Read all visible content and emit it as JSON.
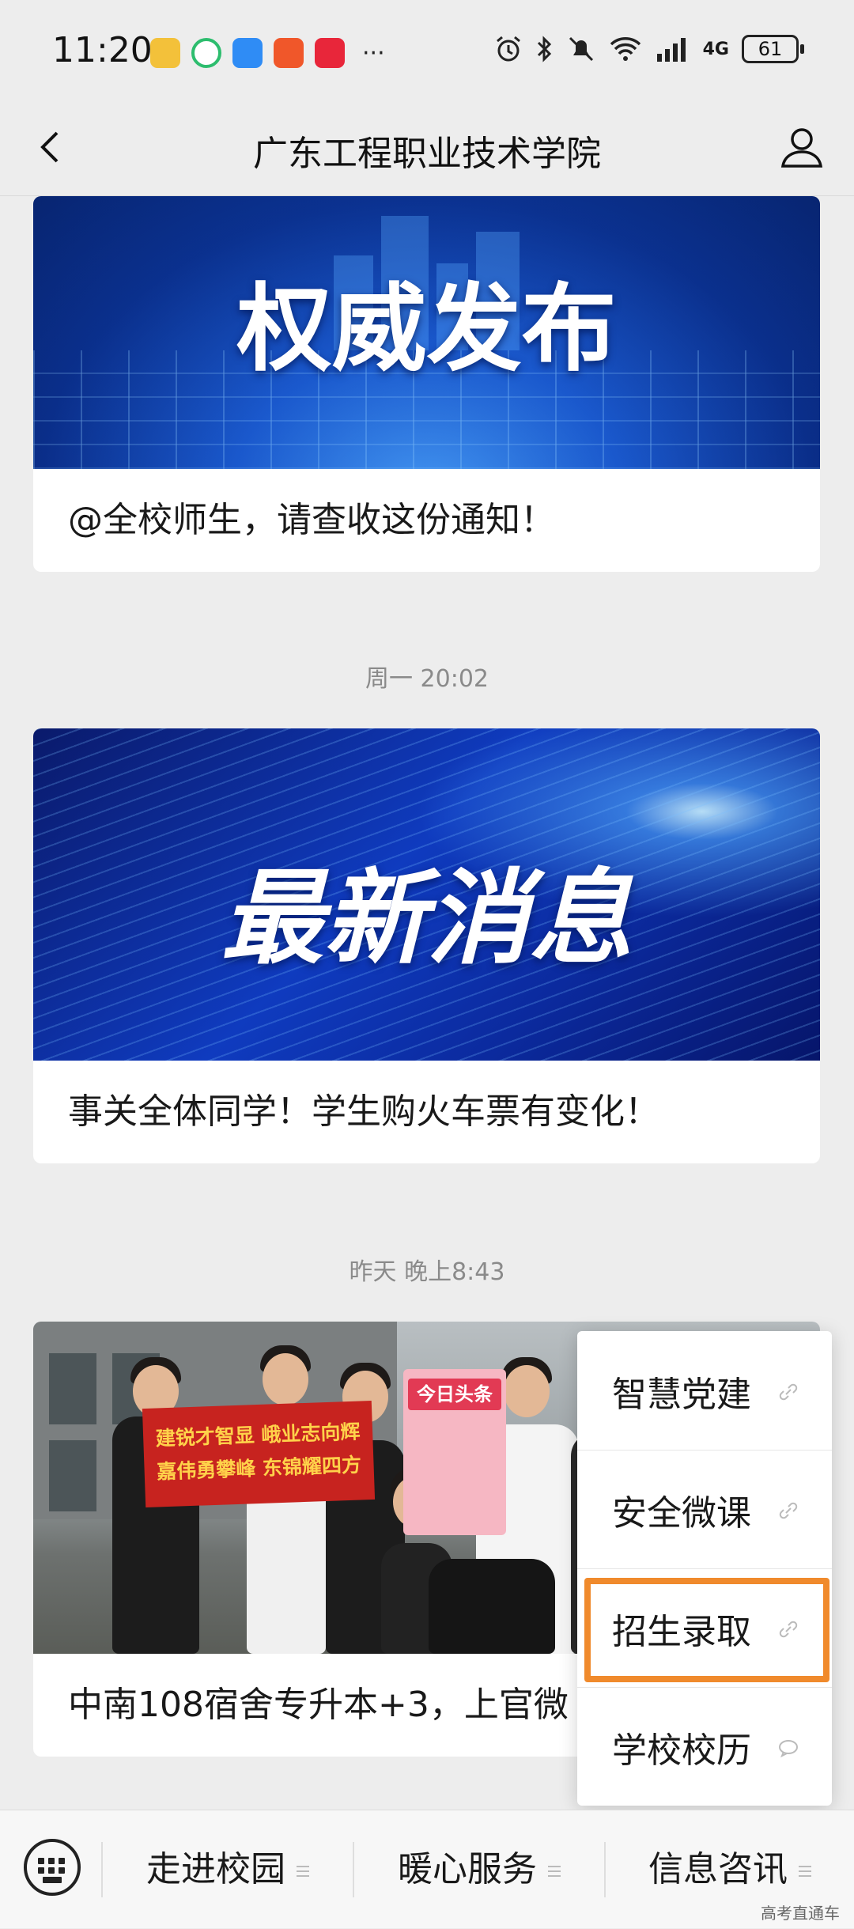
{
  "status_bar": {
    "time": "11:20",
    "battery": "61",
    "signal": "4G",
    "apps": [
      "weibo-icon",
      "app-green-icon",
      "message-icon",
      "listen-app-icon",
      "health-app-icon"
    ],
    "more": "···"
  },
  "header": {
    "title": "广东工程职业技术学院"
  },
  "feed": {
    "items": [
      {
        "banner_title": "权威发布",
        "caption": "@全校师生，请查收这份通知！"
      },
      {
        "timestamp": "周一 20:02",
        "banner_title": "最新消息",
        "caption": "事关全体同学！学生购火车票有变化！"
      },
      {
        "timestamp": "昨天 晚上8:43",
        "caption": "中南108宿舍专升本+3，上官微",
        "photo_banner_text": [
          "建锐才智显 峨业志向辉",
          "嘉伟勇攀峰 东锦耀四方"
        ],
        "photo_sign_text": "今日头条"
      }
    ]
  },
  "popup_menu": {
    "items": [
      {
        "label": "智慧党建",
        "icon": "link-icon"
      },
      {
        "label": "安全微课",
        "icon": "link-icon"
      },
      {
        "label": "招生录取",
        "icon": "link-icon",
        "highlighted": true
      },
      {
        "label": "学校校历",
        "icon": "chat-bubble-icon"
      }
    ],
    "highlight_color": "#f08a2c"
  },
  "bottom_menu": {
    "tabs": [
      "走进校园",
      "暖心服务",
      "信息咨讯"
    ]
  },
  "watermark": "高考直通车",
  "colors": {
    "background": "#ededed",
    "card": "#ffffff",
    "banner_blue": "#1d5fd6"
  }
}
